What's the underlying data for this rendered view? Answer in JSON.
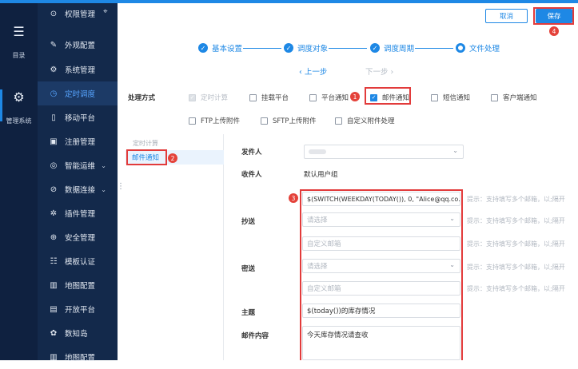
{
  "rail": {
    "menu_label": "目录",
    "admin_label": "管理系统"
  },
  "sidebar": {
    "items": [
      {
        "label": "权限管理",
        "icon": "shield-user-icon"
      },
      {
        "label": "外观配置",
        "icon": "brush-icon"
      },
      {
        "label": "系统管理",
        "icon": "gear-icon"
      },
      {
        "label": "定时调度",
        "icon": "clock-icon",
        "active": true
      },
      {
        "label": "移动平台",
        "icon": "mobile-icon"
      },
      {
        "label": "注册管理",
        "icon": "register-icon"
      },
      {
        "label": "智能运维",
        "icon": "ops-icon",
        "expandable": true
      },
      {
        "label": "数据连接",
        "icon": "link-icon",
        "expandable": true
      },
      {
        "label": "插件管理",
        "icon": "plugin-icon"
      },
      {
        "label": "安全管理",
        "icon": "security-icon"
      },
      {
        "label": "模板认证",
        "icon": "template-icon"
      },
      {
        "label": "地图配置",
        "icon": "map-icon"
      },
      {
        "label": "开放平台",
        "icon": "open-platform-icon"
      },
      {
        "label": "数知岛",
        "icon": "island-icon"
      },
      {
        "label": "地图配置",
        "icon": "map-icon"
      }
    ]
  },
  "header": {
    "cancel_label": "取消",
    "save_label": "保存"
  },
  "steps": {
    "items": [
      "基本设置",
      "调度对象",
      "调度周期",
      "文件处理"
    ],
    "prev": "上一步",
    "next": "下一步"
  },
  "processing": {
    "label": "处理方式",
    "options_row1": [
      "定时计算",
      "挂载平台",
      "平台通知",
      "邮件通知",
      "短信通知",
      "客户端通知"
    ],
    "options_row2": [
      "FTP上传附件",
      "SFTP上传附件",
      "自定义附件处理"
    ]
  },
  "left_panel": {
    "header": "定时计算",
    "selected": "邮件通知"
  },
  "form": {
    "sender_label": "发件人",
    "recipient_label": "收件人",
    "recipient_value": "默认用户组",
    "recipient_formula": "$(SWITCH(WEEKDAY(TODAY()), 0, \"Alice@qq.co...",
    "cc_label": "抄送",
    "bcc_label": "密送",
    "select_placeholder": "请选择",
    "custom_email_placeholder": "自定义邮箱",
    "tip": "提示：支持填写多个邮箱，以;隔开",
    "subject_label": "主题",
    "subject_value": "$(today())的库存情况",
    "content_label": "邮件内容",
    "content_value": "今天库存情况请查收"
  },
  "badges": [
    "1",
    "2",
    "3",
    "4"
  ],
  "colors": {
    "accent": "#1e88e5",
    "nav_bg": "#13294b",
    "rail_bg": "#0f2140",
    "highlight": "#e23b3b"
  }
}
